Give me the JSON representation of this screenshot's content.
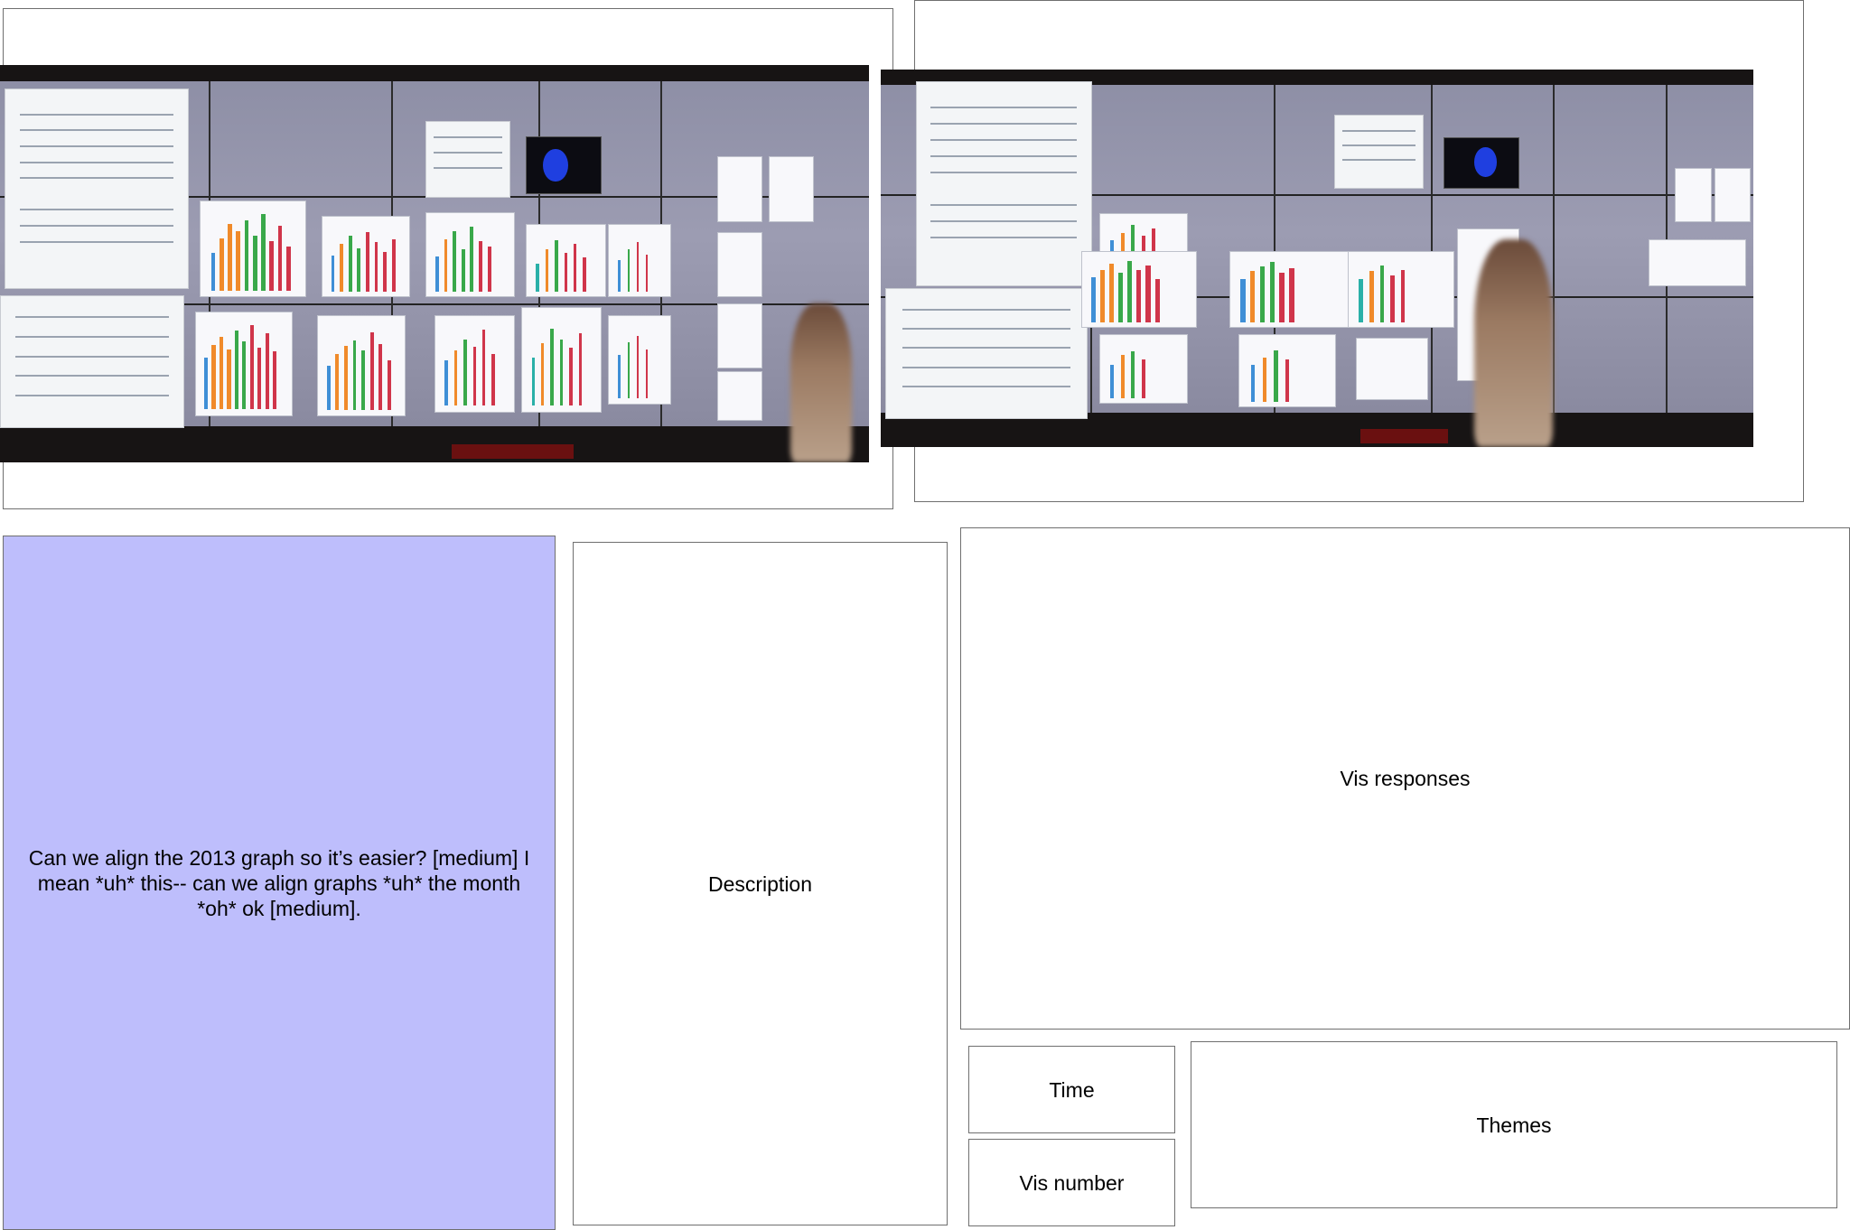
{
  "photos": [
    {
      "name": "display-wall-photo-left"
    },
    {
      "name": "display-wall-photo-right"
    }
  ],
  "utterance": {
    "text": "Can we align the 2013 graph so it’s easier? [medium] I mean *uh* this-- can we align graphs *uh* the month *oh* ok [medium].",
    "background": "#bebefc"
  },
  "panels": {
    "description": "Description",
    "vis_responses": "Vis responses",
    "time": "Time",
    "vis_number": "Vis number",
    "themes": "Themes"
  },
  "colors": {
    "border": "#6f6f6f",
    "bar_blue": "#3f8fd6",
    "bar_orange": "#f08a2a",
    "bar_green": "#39a84a",
    "bar_red": "#d0354a",
    "bar_teal": "#2ab0a8"
  }
}
